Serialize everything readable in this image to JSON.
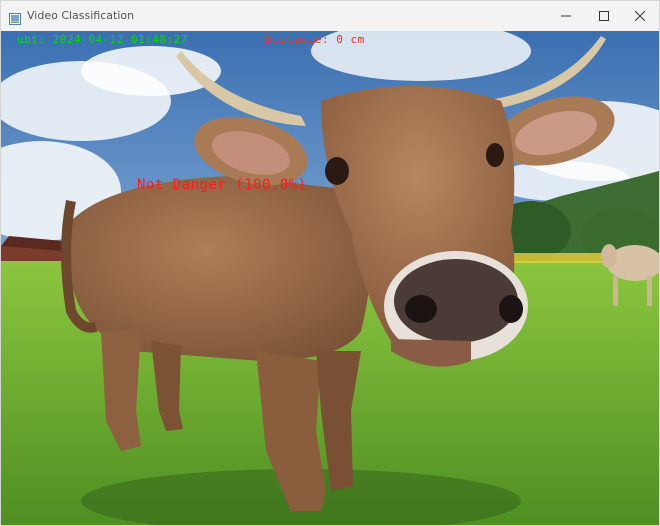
{
  "window": {
    "title": "Video Classification",
    "icon": "app-window-icon",
    "controls": {
      "minimize_icon": "minimize-icon",
      "maximize_icon": "maximize-icon",
      "close_icon": "close-icon"
    }
  },
  "overlay": {
    "timestamp": "ubt: 2024-04-12 01:48:27",
    "distance": "Distance: 0 cm",
    "classification": "Not Danger (100.0%)",
    "colors": {
      "timestamp": "#00e000",
      "distance": "#ff2a2a",
      "classification": "#ff1a1a"
    }
  },
  "frame": {
    "subject": "cow-in-pasture",
    "sky_color": "#4f86c6",
    "grass_color": "#6fae2f"
  }
}
